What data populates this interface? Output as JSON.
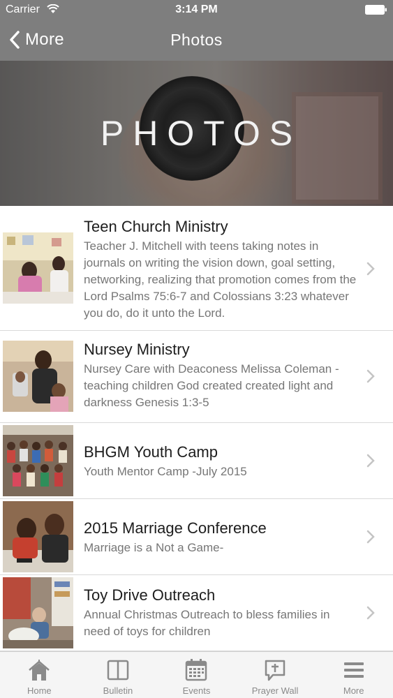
{
  "status": {
    "carrier": "Carrier",
    "time": "3:14 PM"
  },
  "nav": {
    "back_label": "More",
    "title": "Photos"
  },
  "hero": {
    "title": "PHOTOS"
  },
  "items": [
    {
      "title": "Teen Church Ministry",
      "description": "Teacher J. Mitchell with teens taking notes in journals on writing the vision down, goal setting, networking, realizing that promotion comes from the Lord Psalms 75:6-7 and Colossians 3:23 whatever you do, do it unto the Lord."
    },
    {
      "title": "Nursey Ministry",
      "description": "Nursey Care with Deaconess Melissa Coleman - teaching children  God created created light and darkness Genesis 1:3-5"
    },
    {
      "title": "BHGM Youth Camp",
      "description": "Youth Mentor Camp -July 2015"
    },
    {
      "title": "2015 Marriage Conference",
      "description": "Marriage is a Not a Game-"
    },
    {
      "title": "Toy Drive Outreach",
      "description": "Annual Christmas Outreach to bless families in need of toys for children"
    }
  ],
  "tabs": [
    {
      "label": "Home",
      "icon": "home-icon"
    },
    {
      "label": "Bulletin",
      "icon": "bulletin-icon"
    },
    {
      "label": "Events",
      "icon": "calendar-icon"
    },
    {
      "label": "Prayer Wall",
      "icon": "prayer-icon"
    },
    {
      "label": "More",
      "icon": "menu-icon"
    }
  ],
  "colors": {
    "bar": "#7e7e7e",
    "tab_icon": "#8a8a8a",
    "divider": "#d9d9d9"
  }
}
